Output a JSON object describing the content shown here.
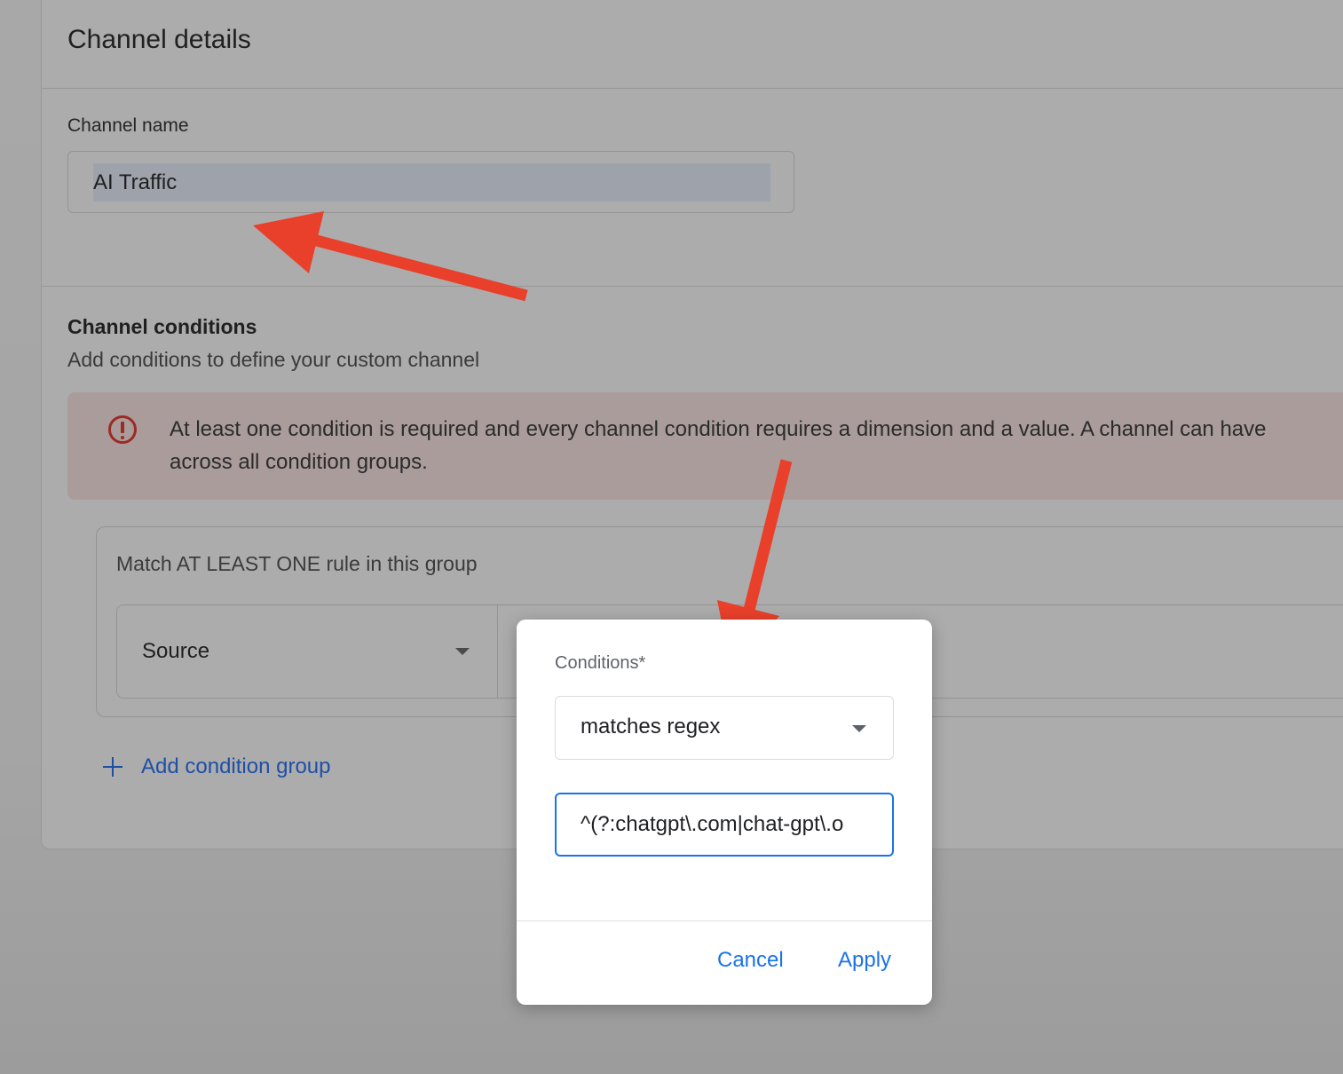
{
  "card": {
    "title": "Channel details"
  },
  "channel_name": {
    "label": "Channel name",
    "value": "AI Traffic"
  },
  "conditions_section": {
    "title": "Channel conditions",
    "subtitle": "Add conditions to define your custom channel",
    "error_line1": "At least one condition is required and every channel condition requires a dimension and a value. A channel can have",
    "error_line2": "across all condition groups.",
    "group_title": "Match AT LEAST ONE rule in this group",
    "dimension": "Source",
    "add_group_label": "Add condition group"
  },
  "dialog": {
    "label": "Conditions*",
    "operator": "matches regex",
    "value": "^(?:chatgpt\\.com|chat-gpt\\.o",
    "cancel_label": "Cancel",
    "apply_label": "Apply"
  },
  "colors": {
    "accent": "#1a73e8",
    "link": "#1d4fa6",
    "error": "#9b2b25",
    "annotation": "#e8402a"
  },
  "icons": [
    "error-icon",
    "plus-icon",
    "chevron-down-icon",
    "annotation-arrow"
  ]
}
